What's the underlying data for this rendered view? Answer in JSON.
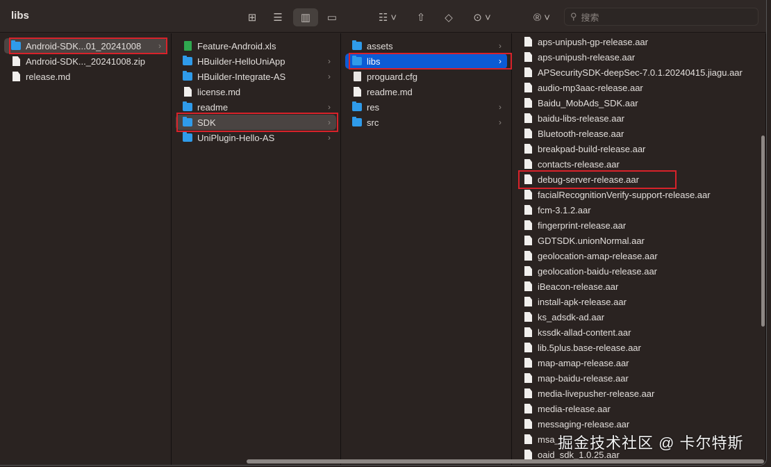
{
  "window": {
    "title": "libs"
  },
  "toolbar": {
    "icons": [
      "grid-view-icon",
      "list-view-icon",
      "column-view-icon",
      "gallery-view-icon",
      "group-icon",
      "share-icon",
      "tag-icon",
      "more-icon",
      "registered-icon"
    ],
    "search_placeholder": "搜索",
    "active_view": "column"
  },
  "colors": {
    "selection_blue": "#0b5bd4",
    "selection_gray": "#4a4442",
    "highlight_box": "#d8222a",
    "folder": "#2f9bea"
  },
  "columns": [
    {
      "items": [
        {
          "name": "Android-SDK...01_20241008",
          "type": "folder",
          "chevron": true,
          "selected": "gray",
          "highlighted": true
        },
        {
          "name": "Android-SDK..._20241008.zip",
          "type": "file"
        },
        {
          "name": "release.md",
          "type": "file"
        }
      ]
    },
    {
      "items": [
        {
          "name": "Feature-Android.xls",
          "type": "xls"
        },
        {
          "name": "HBuilder-HelloUniApp",
          "type": "folder",
          "chevron": true
        },
        {
          "name": "HBuilder-Integrate-AS",
          "type": "folder",
          "chevron": true
        },
        {
          "name": "license.md",
          "type": "file"
        },
        {
          "name": "readme",
          "type": "folder",
          "chevron": true
        },
        {
          "name": "SDK",
          "type": "folder",
          "chevron": true,
          "selected": "gray",
          "highlighted": true
        },
        {
          "name": "UniPlugin-Hello-AS",
          "type": "folder",
          "chevron": true
        }
      ]
    },
    {
      "items": [
        {
          "name": "assets",
          "type": "folder",
          "chevron": true
        },
        {
          "name": "libs",
          "type": "folder",
          "chevron": true,
          "selected": "blue",
          "highlighted": true
        },
        {
          "name": "proguard.cfg",
          "type": "cfg"
        },
        {
          "name": "readme.md",
          "type": "file"
        },
        {
          "name": "res",
          "type": "folder",
          "chevron": true
        },
        {
          "name": "src",
          "type": "folder",
          "chevron": true
        }
      ]
    },
    {
      "items": [
        {
          "name": "aps-unipush-gp-release.aar",
          "type": "file"
        },
        {
          "name": "aps-unipush-release.aar",
          "type": "file"
        },
        {
          "name": "APSecuritySDK-deepSec-7.0.1.20240415.jiagu.aar",
          "type": "file"
        },
        {
          "name": "audio-mp3aac-release.aar",
          "type": "file"
        },
        {
          "name": "Baidu_MobAds_SDK.aar",
          "type": "file"
        },
        {
          "name": "baidu-libs-release.aar",
          "type": "file"
        },
        {
          "name": "Bluetooth-release.aar",
          "type": "file"
        },
        {
          "name": "breakpad-build-release.aar",
          "type": "file"
        },
        {
          "name": "contacts-release.aar",
          "type": "file"
        },
        {
          "name": "debug-server-release.aar",
          "type": "file",
          "highlighted": true
        },
        {
          "name": "facialRecognitionVerify-support-release.aar",
          "type": "file"
        },
        {
          "name": "fcm-3.1.2.aar",
          "type": "file"
        },
        {
          "name": "fingerprint-release.aar",
          "type": "file"
        },
        {
          "name": "GDTSDK.unionNormal.aar",
          "type": "file"
        },
        {
          "name": "geolocation-amap-release.aar",
          "type": "file"
        },
        {
          "name": "geolocation-baidu-release.aar",
          "type": "file"
        },
        {
          "name": "iBeacon-release.aar",
          "type": "file"
        },
        {
          "name": "install-apk-release.aar",
          "type": "file"
        },
        {
          "name": "ks_adsdk-ad.aar",
          "type": "file"
        },
        {
          "name": "kssdk-allad-content.aar",
          "type": "file"
        },
        {
          "name": "lib.5plus.base-release.aar",
          "type": "file"
        },
        {
          "name": "map-amap-release.aar",
          "type": "file"
        },
        {
          "name": "map-baidu-release.aar",
          "type": "file"
        },
        {
          "name": "media-livepusher-release.aar",
          "type": "file"
        },
        {
          "name": "media-release.aar",
          "type": "file"
        },
        {
          "name": "messaging-release.aar",
          "type": "file"
        },
        {
          "name": "msa_",
          "type": "file"
        },
        {
          "name": "oaid_sdk_1.0.25.aar",
          "type": "file"
        }
      ]
    }
  ],
  "watermark": "掘金技术社区 @ 卡尔特斯"
}
